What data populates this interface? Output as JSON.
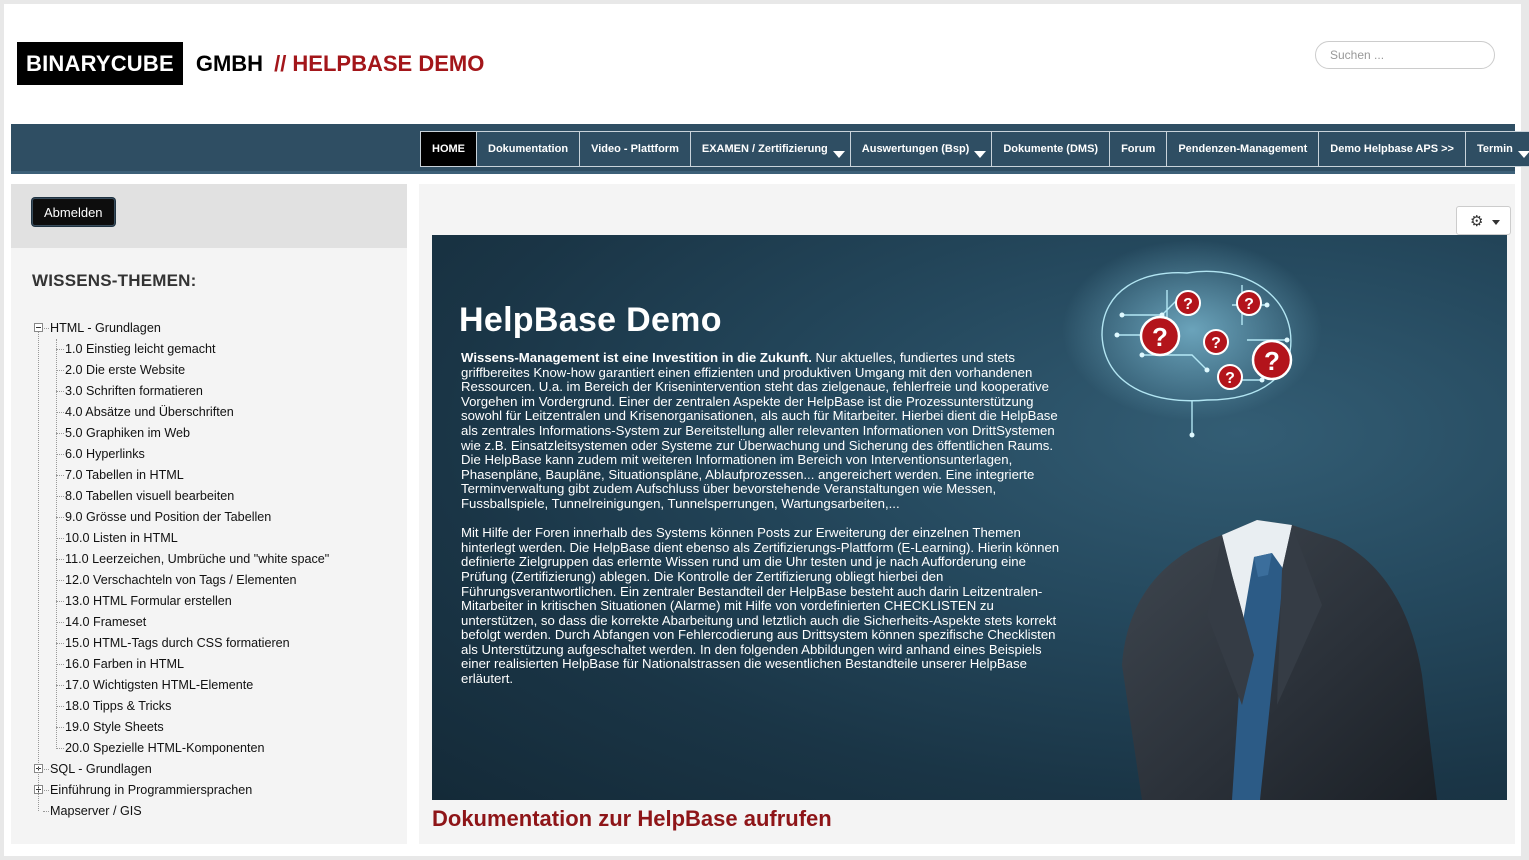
{
  "header": {
    "logo_box": "BINARYCUBE",
    "logo_gmbh": "GMBH",
    "logo_sub": "// HELPBASE DEMO",
    "search_placeholder": "Suchen ..."
  },
  "nav": {
    "items": [
      {
        "label": "HOME",
        "active": true,
        "dropdown": false
      },
      {
        "label": "Dokumentation",
        "active": false,
        "dropdown": false
      },
      {
        "label": "Video - Plattform",
        "active": false,
        "dropdown": false
      },
      {
        "label": "EXAMEN / Zertifizierung",
        "active": false,
        "dropdown": true
      },
      {
        "label": "Auswertungen (Bsp)",
        "active": false,
        "dropdown": true
      },
      {
        "label": "Dokumente (DMS)",
        "active": false,
        "dropdown": false
      },
      {
        "label": "Forum",
        "active": false,
        "dropdown": false
      },
      {
        "label": "Pendenzen-Management",
        "active": false,
        "dropdown": false
      },
      {
        "label": "Demo Helpbase APS >>",
        "active": false,
        "dropdown": false
      },
      {
        "label": "Termin",
        "active": false,
        "dropdown": true
      }
    ]
  },
  "sidebar": {
    "logout_label": "Abmelden",
    "title": "WISSENS-THEMEN:",
    "tree": [
      {
        "label": "HTML - Grundlagen",
        "expanded": true,
        "children": [
          "1.0 Einstieg leicht gemacht",
          "2.0 Die erste Website",
          "3.0 Schriften formatieren",
          "4.0 Absätze und Überschriften",
          "5.0 Graphiken im Web",
          "6.0 Hyperlinks",
          "7.0 Tabellen in HTML",
          "8.0 Tabellen visuell bearbeiten",
          "9.0 Grösse und Position der Tabellen",
          "10.0 Listen in HTML",
          "11.0 Leerzeichen, Umbrüche und \"white space\"",
          "12.0 Verschachteln von Tags / Elementen",
          "13.0 HTML Formular erstellen",
          "14.0 Frameset",
          "15.0 HTML-Tags durch CSS formatieren",
          "16.0 Farben in HTML",
          "17.0 Wichtigsten HTML-Elemente",
          "18.0 Tipps & Tricks",
          "19.0 Style Sheets",
          "20.0 Spezielle HTML-Komponenten"
        ]
      },
      {
        "label": "SQL - Grundlagen",
        "expanded": false,
        "children": []
      },
      {
        "label": "Einführung in Programmiersprachen",
        "expanded": false,
        "children": []
      },
      {
        "label": "Mapserver / GIS",
        "expanded": null,
        "children": []
      }
    ]
  },
  "main": {
    "gear_icon": "gear-icon",
    "banner": {
      "title": "HelpBase Demo",
      "intro_bold": "Wissens-Management ist eine Investition in die Zukunft.",
      "para1": " Nur aktuelles, fundiertes und stets griffbereites Know-how garantiert einen effizienten und produktiven Umgang mit den vorhandenen Ressourcen. U.a. im Bereich der Krisenintervention steht das zielgenaue, fehlerfreie und kooperative Vorgehen im Vordergrund. Einer der zentralen Aspekte der HelpBase ist die Prozessunterstützung sowohl für Leitzentralen und Krisenorganisationen, als auch für Mitarbeiter. Hierbei dient die HelpBase als zentrales Informations-System zur Bereitstellung aller relevanten Informationen von DrittSystemen wie z.B. Einsatzleitsystemen oder Systeme zur Überwachung und Sicherung des öffentlichen Raums. Die HelpBase kann zudem mit weiteren Informationen im Bereich von Interventionsunterlagen, Phasenpläne, Baupläne, Situationspläne, Ablaufprozessen... angereichert werden. Eine integrierte Terminverwaltung gibt zudem Aufschluss über bevorstehende Veranstaltungen wie Messen, Fussballspiele, Tunnelreinigungen, Tunnelsperrungen, Wartungsarbeiten,...",
      "para2": "Mit Hilfe der Foren innerhalb des Systems können Posts zur Erweiterung der einzelnen Themen hinterlegt werden. Die HelpBase dient ebenso als Zertifizierungs-Plattform (E-Learning). Hierin können definierte Zielgruppen das erlernte Wissen rund um die Uhr testen und je nach Aufforderung eine Prüfung (Zertifizierung) ablegen. Die Kontrolle der Zertifizierung obliegt hierbei den Führungsverantwortlichen. Ein zentraler Bestandteil der HelpBase besteht auch darin Leitzentralen-Mitarbeiter in kritischen Situationen (Alarme) mit Hilfe von vordefinierten CHECKLISTEN zu unterstützen, so dass die korrekte Abarbeitung und letztlich auch die Sicherheits-Aspekte stets korrekt befolgt werden. Durch Abfangen von Fehlercodierung aus Drittsystem können spezifische Checklisten als Unterstützung aufgeschaltet werden. In den folgenden Abbildungen wird anhand eines Beispiels einer realisierten HelpBase für Nationalstrassen die wesentlichen Bestandteile unserer HelpBase erläutert."
    },
    "doc_link": "Dokumentation zur HelpBase aufrufen"
  }
}
